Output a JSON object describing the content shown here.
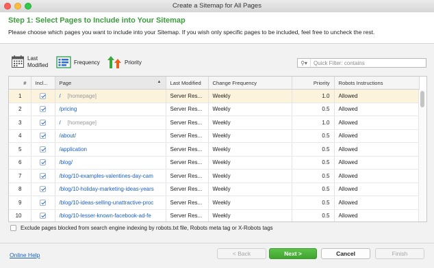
{
  "window": {
    "title": "Create a Sitemap for All Pages"
  },
  "header": {
    "step_title": "Step 1: Select Pages to Include into Your Sitemap",
    "description": "Please choose which pages you want to include into your Sitemap. If you wish only specific pages to be included, feel free to uncheck the rest."
  },
  "toolbar": {
    "last_modified": {
      "line1": "Last",
      "line2": "Modified"
    },
    "frequency_label": "Frequency",
    "priority_label": "Priority",
    "filter_placeholder": "Quick Filter: contains"
  },
  "table": {
    "columns": {
      "num": "#",
      "include": "Incl...",
      "page": "Page",
      "last_modified": "Last Modified",
      "change_frequency": "Change Frequency",
      "priority": "Priority",
      "robots": "Robots Instructions"
    },
    "rows": [
      {
        "num": "1",
        "page": "/",
        "tag": "[homepage]",
        "last_modified": "Server Res...",
        "frequency": "Weekly",
        "priority": "1.0",
        "robots": "Allowed"
      },
      {
        "num": "2",
        "page": "/pricing",
        "tag": "",
        "last_modified": "Server Res...",
        "frequency": "Weekly",
        "priority": "0.5",
        "robots": "Allowed"
      },
      {
        "num": "3",
        "page": "/",
        "tag": "[homepage]",
        "last_modified": "Server Res...",
        "frequency": "Weekly",
        "priority": "1.0",
        "robots": "Allowed"
      },
      {
        "num": "4",
        "page": "/about/",
        "tag": "",
        "last_modified": "Server Res...",
        "frequency": "Weekly",
        "priority": "0.5",
        "robots": "Allowed"
      },
      {
        "num": "5",
        "page": "/application",
        "tag": "",
        "last_modified": "Server Res...",
        "frequency": "Weekly",
        "priority": "0.5",
        "robots": "Allowed"
      },
      {
        "num": "6",
        "page": "/blog/",
        "tag": "",
        "last_modified": "Server Res...",
        "frequency": "Weekly",
        "priority": "0.5",
        "robots": "Allowed"
      },
      {
        "num": "7",
        "page": "/blog/10-examples-valentines-day-cam",
        "tag": "",
        "last_modified": "Server Res...",
        "frequency": "Weekly",
        "priority": "0.5",
        "robots": "Allowed"
      },
      {
        "num": "8",
        "page": "/blog/10-holiday-marketing-ideas-years",
        "tag": "",
        "last_modified": "Server Res...",
        "frequency": "Weekly",
        "priority": "0.5",
        "robots": "Allowed"
      },
      {
        "num": "9",
        "page": "/blog/10-ideas-selling-unattractive-proc",
        "tag": "",
        "last_modified": "Server Res...",
        "frequency": "Weekly",
        "priority": "0.5",
        "robots": "Allowed"
      },
      {
        "num": "10",
        "page": "/blog/10-lesser-known-facebook-ad-fe",
        "tag": "",
        "last_modified": "Server Res...",
        "frequency": "Weekly",
        "priority": "0.5",
        "robots": "Allowed"
      }
    ]
  },
  "exclude_label": "Exclude pages blocked from search engine indexing by robots.txt file, Robots meta tag or X-Robots tags",
  "footer": {
    "help_link": "Online Help",
    "back": "< Back",
    "next": "Next >",
    "cancel": "Cancel",
    "finish": "Finish"
  }
}
